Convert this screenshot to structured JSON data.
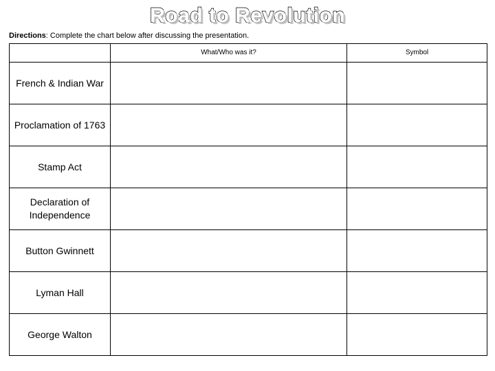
{
  "document": {
    "title": "Road to Revolution",
    "directions": {
      "lead": "Directions",
      "text": ": Complete the chart below after discussing the presentation."
    }
  },
  "chart": {
    "columns": [
      {
        "key": "term",
        "label": ""
      },
      {
        "key": "what",
        "label": "What/Who was it?"
      },
      {
        "key": "symbol",
        "label": "Symbol"
      }
    ],
    "rows": [
      {
        "term": "French & Indian War",
        "what": "",
        "symbol": ""
      },
      {
        "term": "Proclamation of 1763",
        "what": "",
        "symbol": ""
      },
      {
        "term": "Stamp Act",
        "what": "",
        "symbol": ""
      },
      {
        "term": "Declaration of Independence",
        "what": "",
        "symbol": ""
      },
      {
        "term": "Button Gwinnett",
        "what": "",
        "symbol": ""
      },
      {
        "term": "Lyman Hall",
        "what": "",
        "symbol": ""
      },
      {
        "term": "George Walton",
        "what": "",
        "symbol": ""
      }
    ]
  },
  "colors": {
    "text": "#000000",
    "page_background": "#ffffff",
    "border": "#000000",
    "title_fill": "#ffffff",
    "title_outline": "#000000",
    "title_shadow": "#b8b8b8"
  }
}
